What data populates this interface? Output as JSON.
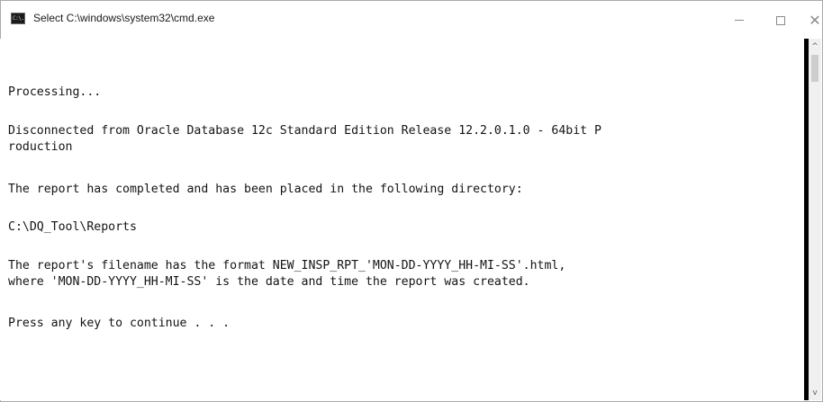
{
  "window": {
    "title": "Select C:\\windows\\system32\\cmd.exe",
    "icon_name": "cmd-icon",
    "icon_text": "C:\\.",
    "minimize_glyph": "minimize-icon",
    "maximize_glyph": "maximize-icon",
    "close_label": "✕"
  },
  "console": {
    "lines": [
      "Processing...",
      "Disconnected from Oracle Database 12c Standard Edition Release 12.2.0.1.0 - 64bit P",
      "roduction",
      "The report has completed and has been placed in the following directory:",
      "C:\\DQ_Tool\\Reports",
      "The report's filename has the format NEW_INSP_RPT_'MON-DD-YYYY_HH-MI-SS'.html,",
      "where 'MON-DD-YYYY_HH-MI-SS' is the date and time the report was created.",
      "Press any key to continue . . ."
    ]
  },
  "scrollbar": {
    "up_arrow": "^",
    "down_arrow": "v"
  },
  "colors": {
    "background": "#ffffff",
    "text": "#141414",
    "scroll_divider": "#000000"
  }
}
